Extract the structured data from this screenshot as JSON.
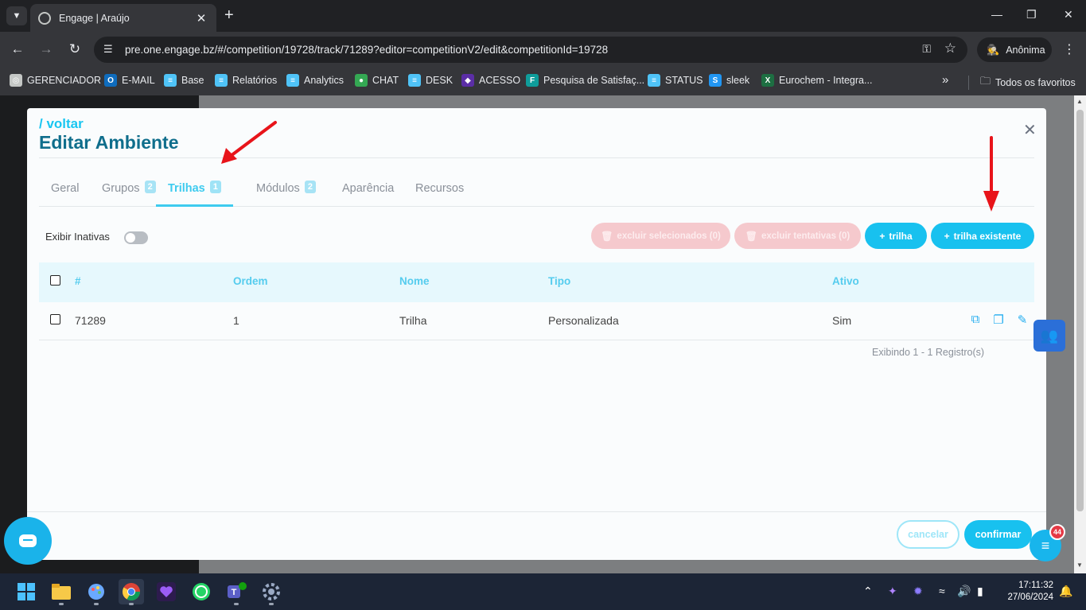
{
  "browser": {
    "tab_title": "Engage | Araújo",
    "url": "pre.one.engage.bz/#/competition/19728/track/71289?editor=competitionV2/edit&competitionId=19728",
    "incognito_label": "Anônima",
    "bookmarks": [
      {
        "label": "GERENCIADOR",
        "icon": "globe-icon",
        "color": "#c4c7c5"
      },
      {
        "label": "E-MAIL",
        "icon": "outlook-icon",
        "color": "#0f6cbd"
      },
      {
        "label": "Base",
        "icon": "engage-icon",
        "color": "#4fc3f7"
      },
      {
        "label": "Relatórios",
        "icon": "engage-icon",
        "color": "#4fc3f7"
      },
      {
        "label": "Analytics",
        "icon": "engage-icon",
        "color": "#4fc3f7"
      },
      {
        "label": "CHAT",
        "icon": "chat-icon",
        "color": "#34a853"
      },
      {
        "label": "DESK",
        "icon": "engage-icon",
        "color": "#4fc3f7"
      },
      {
        "label": "ACESSO",
        "icon": "acesso-icon",
        "color": "#5b2ea6"
      },
      {
        "label": "Pesquisa de Satisfaç...",
        "icon": "forms-icon",
        "color": "#0f9d9b"
      },
      {
        "label": "STATUS",
        "icon": "engage-icon",
        "color": "#4fc3f7"
      },
      {
        "label": "sleek",
        "icon": "sleek-icon",
        "color": "#2196f3"
      },
      {
        "label": "Eurochem - Integra...",
        "icon": "excel-icon",
        "color": "#1d6f42"
      }
    ],
    "all_bookmarks_label": "Todos os favoritos"
  },
  "modal": {
    "back_label": "/ voltar",
    "title": "Editar Ambiente",
    "tabs": [
      {
        "label": "Geral",
        "count": ""
      },
      {
        "label": "Grupos",
        "count": "2"
      },
      {
        "label": "Trilhas",
        "count": "1"
      },
      {
        "label": "Módulos",
        "count": "2"
      },
      {
        "label": "Aparência",
        "count": ""
      },
      {
        "label": "Recursos",
        "count": ""
      }
    ],
    "active_tab": "Trilhas",
    "show_inactive_label": "Exibir Inativas",
    "buttons": {
      "delete_selected": "excluir selecionados (0)",
      "delete_attempts": "excluir tentativas (0)",
      "add_track": "trilha",
      "add_existing_track": "trilha existente"
    },
    "table": {
      "columns": [
        "#",
        "Ordem",
        "Nome",
        "Tipo",
        "Ativo"
      ],
      "rows": [
        {
          "id": "71289",
          "ordem": "1",
          "nome": "Trilha",
          "tipo": "Personalizada",
          "ativo": "Sim"
        }
      ],
      "footer": "Exibindo 1 - 1 Registro(s)"
    },
    "footer": {
      "cancel": "cancelar",
      "confirm": "confirmar"
    }
  },
  "widgets": {
    "notification_count": "44"
  },
  "taskbar": {
    "time": "17:11:32",
    "date": "27/06/2024"
  },
  "colors": {
    "accent": "#18c1ef",
    "title": "#0f6e8c",
    "danger_disabled": "#f5c9cd",
    "annotation_arrow": "#e8141a"
  }
}
